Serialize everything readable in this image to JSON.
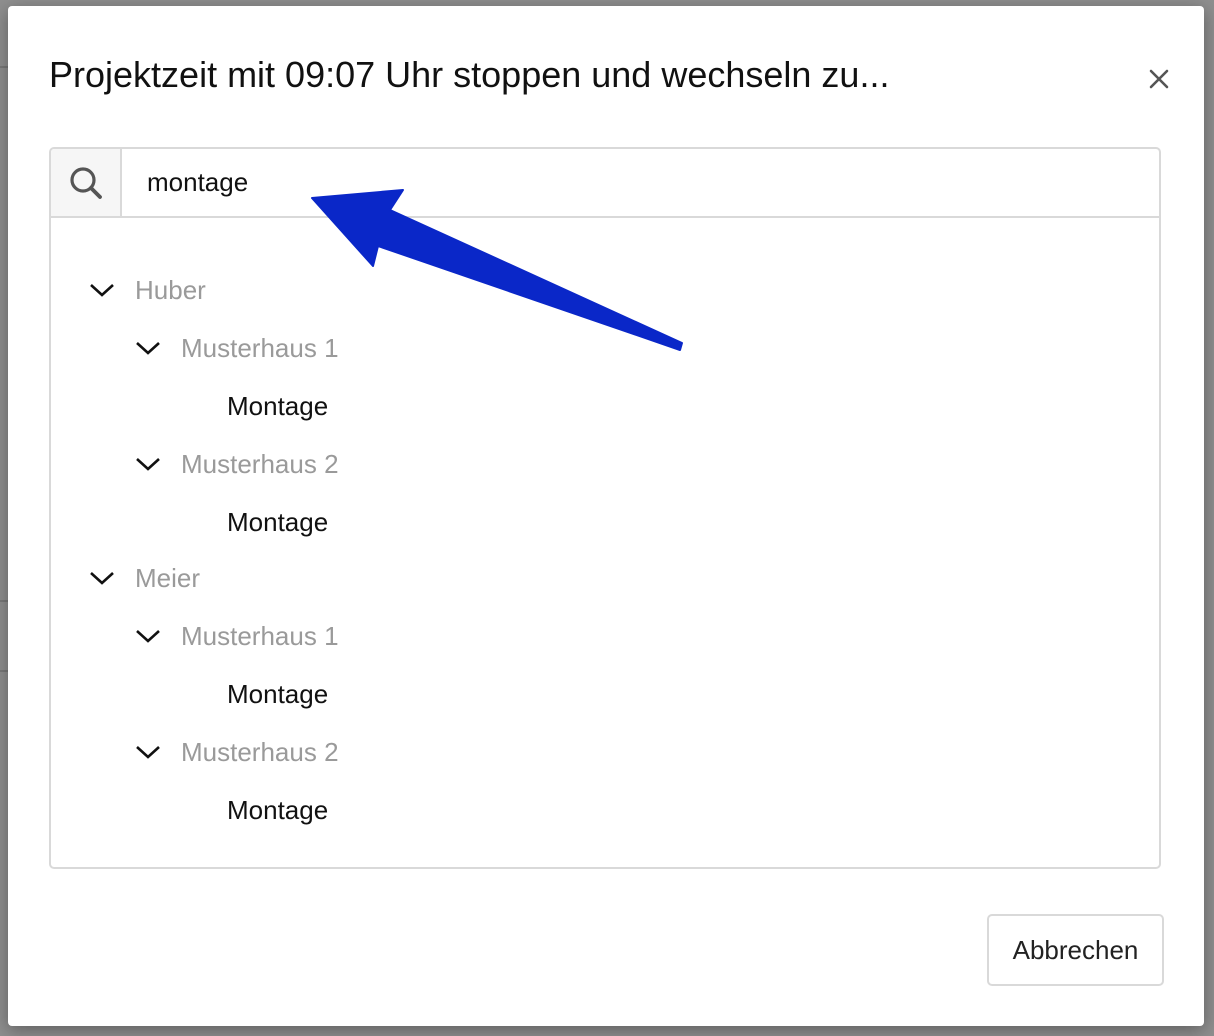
{
  "dialog": {
    "title": "Projektzeit mit 09:07 Uhr stoppen und wechseln zu...",
    "close_icon": "close-icon",
    "search": {
      "icon": "search-icon",
      "value": "montage",
      "placeholder": ""
    },
    "tree": [
      {
        "label": "Huber",
        "expanded": true,
        "children": [
          {
            "label": "Musterhaus 1",
            "expanded": true,
            "children": [
              {
                "label": "Montage"
              }
            ]
          },
          {
            "label": "Musterhaus 2",
            "expanded": true,
            "children": [
              {
                "label": "Montage"
              }
            ]
          }
        ]
      },
      {
        "label": "Meier",
        "expanded": true,
        "children": [
          {
            "label": "Musterhaus 1",
            "expanded": true,
            "children": [
              {
                "label": "Montage"
              }
            ]
          },
          {
            "label": "Musterhaus 2",
            "expanded": true,
            "children": [
              {
                "label": "Montage"
              }
            ]
          }
        ]
      }
    ],
    "cancel_label": "Abbrechen"
  },
  "colors": {
    "annotation_arrow": "#0a27c8",
    "group_label": "#9a9a9a",
    "leaf_label": "#111111",
    "border": "#d9d9d9"
  }
}
